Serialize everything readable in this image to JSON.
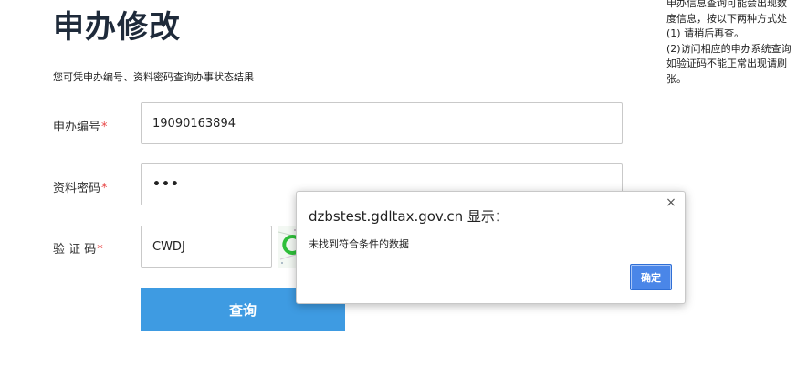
{
  "page": {
    "title": "申办修改",
    "subtitle": "您可凭申办编号、资料密码查询办事状态结果"
  },
  "form": {
    "apply_no": {
      "label": "申办编号",
      "required_mark": "*",
      "value": "19090163894"
    },
    "password": {
      "label": "资料密码",
      "required_mark": "*",
      "value": "•••"
    },
    "captcha": {
      "label": "验 证 码",
      "required_mark": "*",
      "value": "CWDJ"
    },
    "submit_label": "查询"
  },
  "notice": {
    "lines": [
      "申办信息查询可能会出现数",
      "度信息，按以下两种方式处",
      "(1) 请稍后再查。",
      "(2)访问相应的申办系统查询",
      "如验证码不能正常出现请刷",
      "张。"
    ]
  },
  "dialog": {
    "title": "dzbstest.gdltax.gov.cn 显示：",
    "message": "未找到符合条件的数据",
    "ok_label": "确定",
    "close_symbol": "×"
  },
  "colors": {
    "primary_button": "#3e9be2",
    "dialog_button": "#4a86e8",
    "required_mark": "#e84545",
    "title_text": "#1e2a3a"
  }
}
